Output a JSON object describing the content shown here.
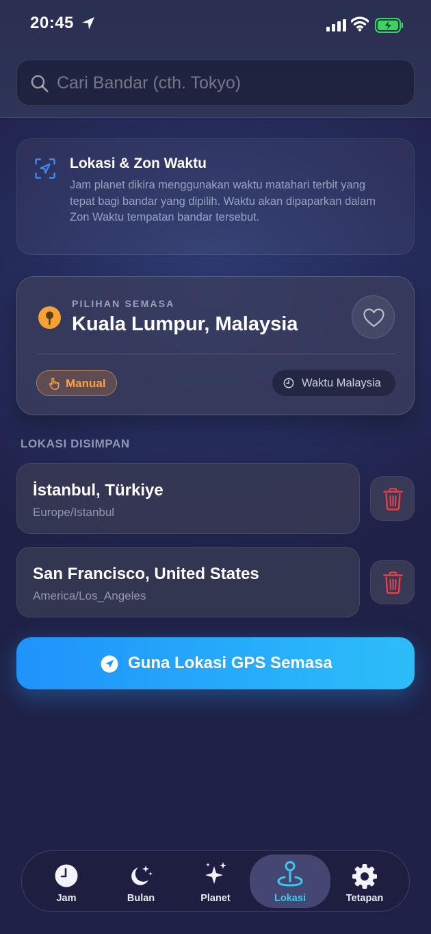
{
  "status_bar": {
    "time": "20:45",
    "icons": [
      "location-arrow-icon",
      "cellular-signal-icon",
      "wifi-icon",
      "battery-charging-icon"
    ]
  },
  "search": {
    "placeholder": "Cari Bandar (cth. Tokyo)",
    "value": ""
  },
  "info_card": {
    "icon": "location-target-icon",
    "title": "Lokasi & Zon Waktu",
    "body": "Jam planet dikira menggunakan waktu matahari terbit yang tepat bagi bandar yang dipilih. Waktu akan dipaparkan dalam Zon Waktu tempatan bandar tersebut."
  },
  "current": {
    "label": "PILIHAN SEMASA",
    "city": "Kuala Lumpur, Malaysia",
    "mode_label": "Manual",
    "timezone_label": "Waktu Malaysia",
    "favorite": false
  },
  "saved": {
    "heading": "LOKASI DISIMPAN",
    "items": [
      {
        "city": "İstanbul, Türkiye",
        "tz": "Europe/Istanbul"
      },
      {
        "city": "San Francisco, United States",
        "tz": "America/Los_Angeles"
      }
    ]
  },
  "gps_button": {
    "label": "Guna Lokasi GPS Semasa"
  },
  "tabs": [
    {
      "label": "Jam",
      "icon": "clock-icon",
      "active": false
    },
    {
      "label": "Bulan",
      "icon": "moon-stars-icon",
      "active": false
    },
    {
      "label": "Planet",
      "icon": "sparkles-icon",
      "active": false
    },
    {
      "label": "Lokasi",
      "icon": "map-pin-icon",
      "active": true
    },
    {
      "label": "Tetapan",
      "icon": "gear-icon",
      "active": false
    }
  ],
  "colors": {
    "accent": "#2cbef9",
    "orange": "#f4a234",
    "danger": "#e0424e",
    "background": "#1f2147"
  }
}
